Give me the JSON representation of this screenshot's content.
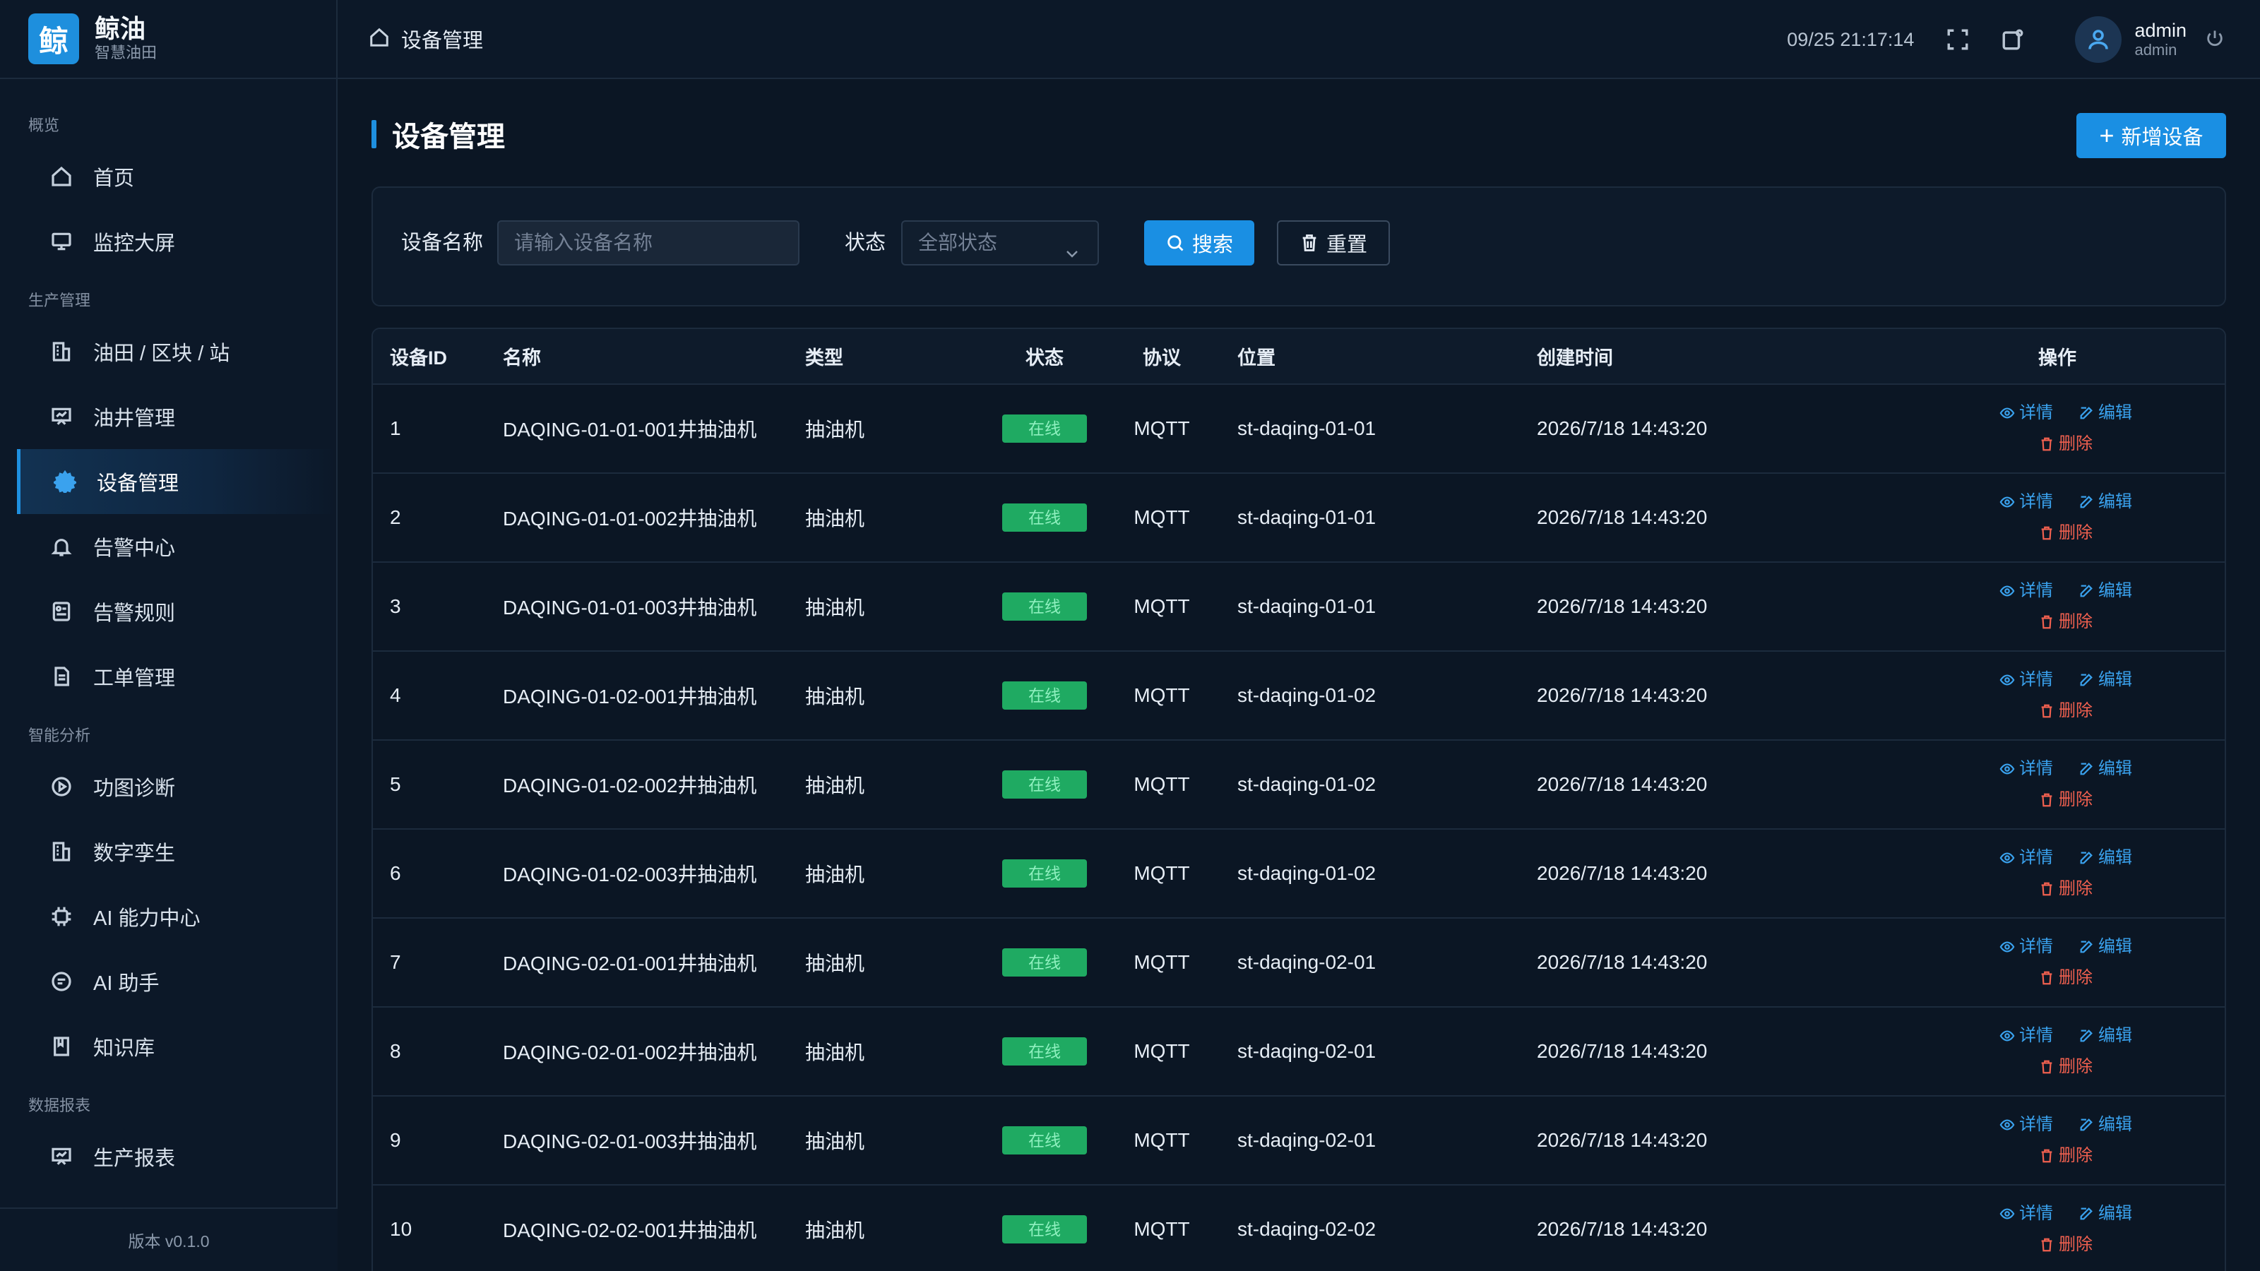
{
  "brand": {
    "logo_char": "鲸",
    "name": "鲸油",
    "subtitle": "智慧油田"
  },
  "sidebar": {
    "groups": [
      {
        "title": "概览",
        "items": [
          {
            "label": "首页",
            "icon": "home-icon"
          },
          {
            "label": "监控大屏",
            "icon": "monitor-icon"
          }
        ]
      },
      {
        "title": "生产管理",
        "items": [
          {
            "label": "油田 / 区块 / 站",
            "icon": "building-icon"
          },
          {
            "label": "油井管理",
            "icon": "easel-icon"
          },
          {
            "label": "设备管理",
            "icon": "gear-icon",
            "active": true
          },
          {
            "label": "告警中心",
            "icon": "bell-icon"
          },
          {
            "label": "告警规则",
            "icon": "rules-icon"
          },
          {
            "label": "工单管理",
            "icon": "document-icon"
          }
        ]
      },
      {
        "title": "智能分析",
        "items": [
          {
            "label": "功图诊断",
            "icon": "play-circle-icon"
          },
          {
            "label": "数字孪生",
            "icon": "building-icon"
          },
          {
            "label": "AI 能力中心",
            "icon": "chip-icon"
          },
          {
            "label": "AI 助手",
            "icon": "chat-icon"
          },
          {
            "label": "知识库",
            "icon": "book-icon"
          }
        ]
      },
      {
        "title": "数据报表",
        "items": [
          {
            "label": "生产报表",
            "icon": "easel-icon"
          }
        ]
      }
    ],
    "version": "版本 v0.1.0"
  },
  "header": {
    "breadcrumb": "设备管理",
    "time": "09/25 21:17:14",
    "user_name": "admin",
    "user_role": "admin"
  },
  "page": {
    "title": "设备管理",
    "add_button": "新增设备"
  },
  "filter": {
    "name_label": "设备名称",
    "name_placeholder": "请输入设备名称",
    "status_label": "状态",
    "status_value": "全部状态",
    "search_button": "搜索",
    "reset_button": "重置"
  },
  "table": {
    "columns": [
      "设备ID",
      "名称",
      "类型",
      "状态",
      "协议",
      "位置",
      "创建时间",
      "操作"
    ],
    "actions": {
      "detail": "详情",
      "edit": "编辑",
      "delete": "删除"
    },
    "rows": [
      {
        "id": "1",
        "name": "DAQING-01-01-001井抽油机",
        "type": "抽油机",
        "status": "在线",
        "protocol": "MQTT",
        "location": "st-daqing-01-01",
        "created": "2026/7/18 14:43:20"
      },
      {
        "id": "2",
        "name": "DAQING-01-01-002井抽油机",
        "type": "抽油机",
        "status": "在线",
        "protocol": "MQTT",
        "location": "st-daqing-01-01",
        "created": "2026/7/18 14:43:20"
      },
      {
        "id": "3",
        "name": "DAQING-01-01-003井抽油机",
        "type": "抽油机",
        "status": "在线",
        "protocol": "MQTT",
        "location": "st-daqing-01-01",
        "created": "2026/7/18 14:43:20"
      },
      {
        "id": "4",
        "name": "DAQING-01-02-001井抽油机",
        "type": "抽油机",
        "status": "在线",
        "protocol": "MQTT",
        "location": "st-daqing-01-02",
        "created": "2026/7/18 14:43:20"
      },
      {
        "id": "5",
        "name": "DAQING-01-02-002井抽油机",
        "type": "抽油机",
        "status": "在线",
        "protocol": "MQTT",
        "location": "st-daqing-01-02",
        "created": "2026/7/18 14:43:20"
      },
      {
        "id": "6",
        "name": "DAQING-01-02-003井抽油机",
        "type": "抽油机",
        "status": "在线",
        "protocol": "MQTT",
        "location": "st-daqing-01-02",
        "created": "2026/7/18 14:43:20"
      },
      {
        "id": "7",
        "name": "DAQING-02-01-001井抽油机",
        "type": "抽油机",
        "status": "在线",
        "protocol": "MQTT",
        "location": "st-daqing-02-01",
        "created": "2026/7/18 14:43:20"
      },
      {
        "id": "8",
        "name": "DAQING-02-01-002井抽油机",
        "type": "抽油机",
        "status": "在线",
        "protocol": "MQTT",
        "location": "st-daqing-02-01",
        "created": "2026/7/18 14:43:20"
      },
      {
        "id": "9",
        "name": "DAQING-02-01-003井抽油机",
        "type": "抽油机",
        "status": "在线",
        "protocol": "MQTT",
        "location": "st-daqing-02-01",
        "created": "2026/7/18 14:43:20"
      },
      {
        "id": "10",
        "name": "DAQING-02-02-001井抽油机",
        "type": "抽油机",
        "status": "在线",
        "protocol": "MQTT",
        "location": "st-daqing-02-02",
        "created": "2026/7/18 14:43:20"
      }
    ]
  },
  "colors": {
    "accent": "#1a8fe3",
    "online": "#1faa62",
    "danger": "#f0604f",
    "background": "#0b1624"
  }
}
